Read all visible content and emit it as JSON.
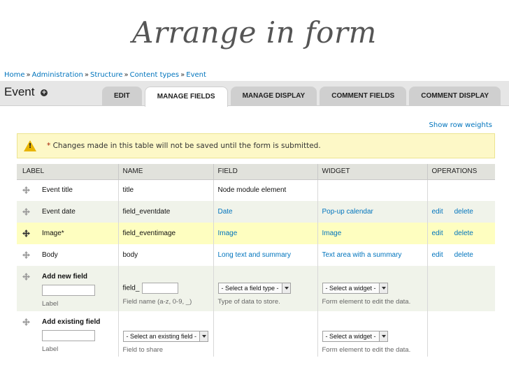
{
  "slide_title": "Arrange in form",
  "breadcrumb": [
    "Home",
    "Administration",
    "Structure",
    "Content types",
    "Event"
  ],
  "breadcrumb_sep": "»",
  "page_title": "Event",
  "tabs": [
    "EDIT",
    "MANAGE FIELDS",
    "MANAGE DISPLAY",
    "COMMENT FIELDS",
    "COMMENT DISPLAY"
  ],
  "active_tab": "MANAGE FIELDS",
  "row_weights_link": "Show row weights",
  "warning": {
    "star": "*",
    "text": " Changes made in this table will not be saved until the form is submitted.",
    "icon": "warning-triangle-icon",
    "mark": "!"
  },
  "columns": [
    "LABEL",
    "NAME",
    "FIELD",
    "WIDGET",
    "OPERATIONS"
  ],
  "rows": [
    {
      "label": "Event title",
      "name": "title",
      "field": "Node module element",
      "widget": "",
      "edit": "",
      "delete": ""
    },
    {
      "label": "Event date",
      "name": "field_eventdate",
      "field": "Date",
      "widget": "Pop-up calendar",
      "edit": "edit",
      "delete": "delete"
    },
    {
      "label": "Image*",
      "name": "field_eventimage",
      "field": "Image",
      "widget": "Image",
      "edit": "edit",
      "delete": "delete"
    },
    {
      "label": "Body",
      "name": "body",
      "field": "Long text and summary",
      "widget": "Text area with a summary",
      "edit": "edit",
      "delete": "delete"
    }
  ],
  "add_new": {
    "title": "Add new field",
    "label_help": "Label",
    "name_prefix": "field_",
    "name_help": "Field name (a-z, 0-9, _)",
    "field_select": "- Select a field type -",
    "field_help": "Type of data to store.",
    "widget_select": "- Select a widget -",
    "widget_help": "Form element to edit the data."
  },
  "add_existing": {
    "title": "Add existing field",
    "label_help": "Label",
    "field_select": "- Select an existing field -",
    "field_help": "Field to share",
    "widget_select": "- Select a widget -",
    "widget_help": "Form element to edit the data."
  },
  "colors": {
    "link": "#0074bd",
    "highlight_row": "#fefec0",
    "warning_bg": "#fdf8c7"
  }
}
